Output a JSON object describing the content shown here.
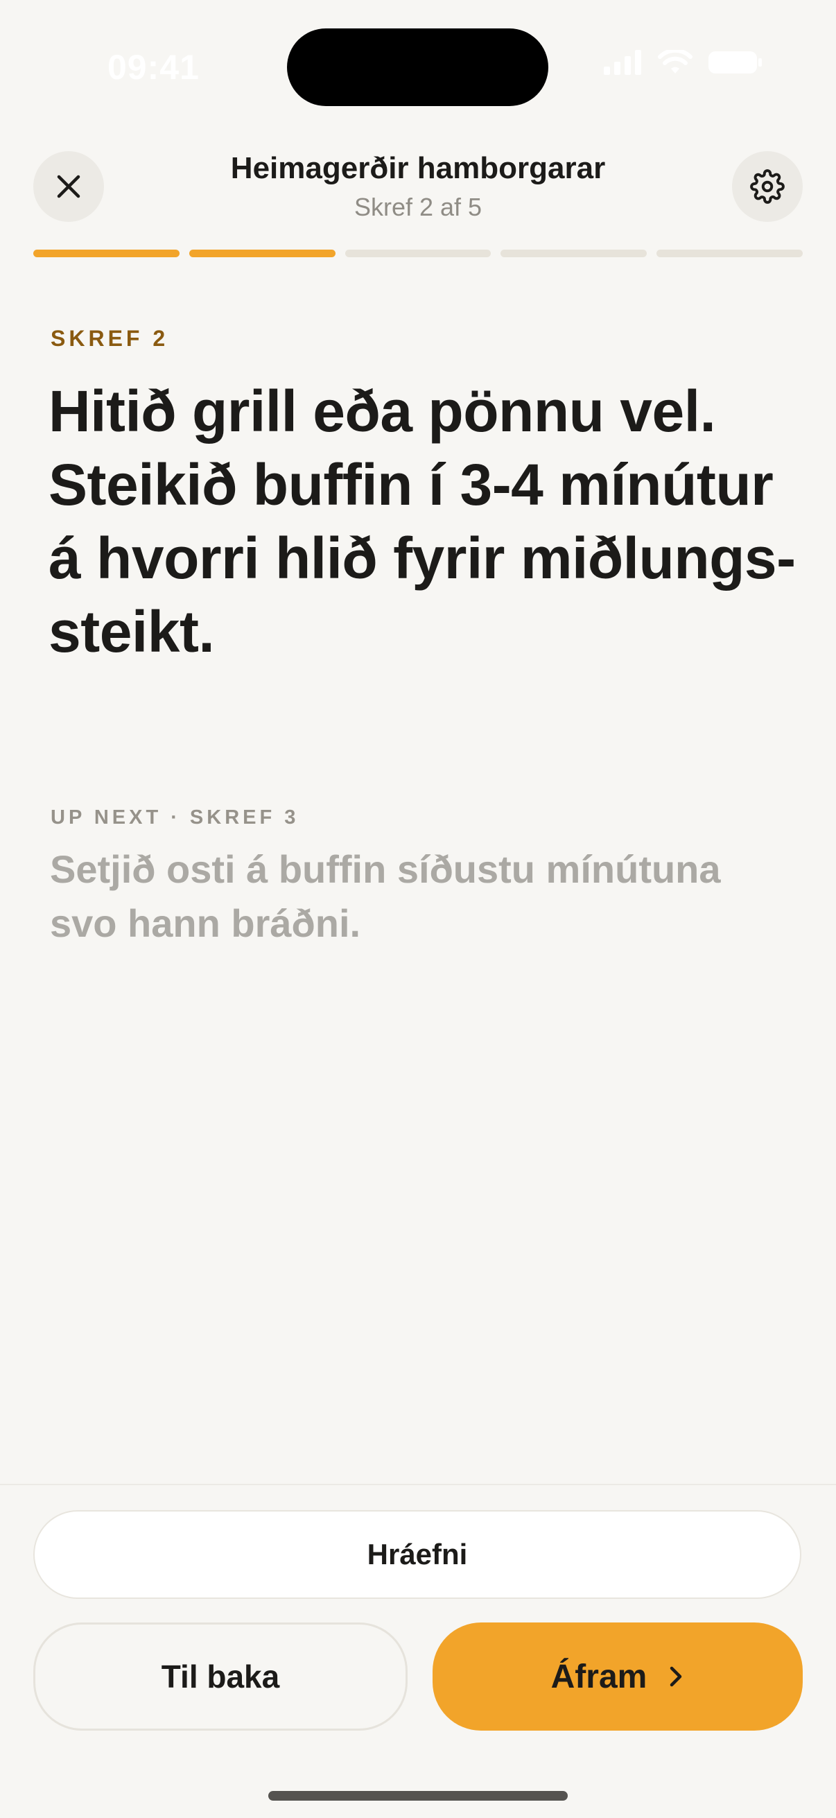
{
  "status_bar": {
    "time": "09:41",
    "icons": [
      "cellular-signal-icon",
      "wifi-icon",
      "battery-icon"
    ]
  },
  "header": {
    "title": "Heimagerðir hamborgarar",
    "subtitle": "Skref 2 af 5",
    "close_icon": "close-icon",
    "settings_icon": "gear-icon"
  },
  "progress": {
    "current_step": 2,
    "total_steps": 5
  },
  "step": {
    "label": "SKREF 2",
    "text": "Hitið grill eða pönnu vel. Steikið buffin í 3-4 mínútur á hvorri hlið fyrir miðlungs-steikt."
  },
  "up_next": {
    "label": "UP NEXT · SKREF 3",
    "text": "Setjið osti á buffin síðustu mínútuna svo hann bráðni."
  },
  "actions": {
    "ingredients_label": "Hráefni",
    "back_label": "Til baka",
    "next_label": "Áfram",
    "next_icon": "chevron-right-icon"
  },
  "colors": {
    "accent": "#F2A42A",
    "background": "#F7F6F3",
    "step_label": "#8A5A10",
    "muted_text": "#ABA9A4"
  }
}
